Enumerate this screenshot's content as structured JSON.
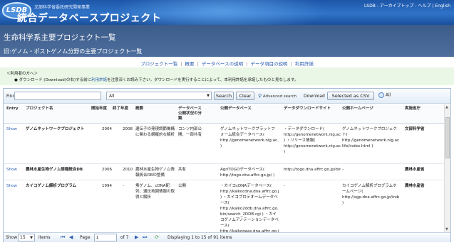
{
  "header": {
    "logo_text": "LSDB",
    "subtitle": "文部科学省委託研究開発事業",
    "brand_name": "統合データベースプロジェクト",
    "top_links": [
      "LSDB",
      "アーカイブトップ",
      "ヘルプ",
      "English"
    ],
    "top_link_separators": [
      " - ",
      " - ",
      " | "
    ]
  },
  "page": {
    "title": "生命科学系主要プロジェクト一覧",
    "subtitle": "旧:ゲノム・ポストゲノム分野の主要プロジェクト一覧"
  },
  "nav": {
    "links": [
      "プロジェクト一覧",
      "概要",
      "データベースの説明",
      "データ項目の説明",
      "利用許諾"
    ],
    "separator": "|"
  },
  "notice": {
    "heading": "＜利用者の方へ＞",
    "bullet": "●",
    "before": "ダウンロード (Download)の右)する前に",
    "link": "利用許諾",
    "after": "を注意深くお読み下さい。ダウンロードを実行することによって、本利用許諾を承諾したものと見なします。"
  },
  "toolbar": {
    "find_label": "Find",
    "find_value": "",
    "filter_value": "All",
    "search_button": "Search",
    "clear_button": "Clear",
    "advanced_search": "Advanced search",
    "download_label": "Download",
    "download_button": "Selected as CSV",
    "all_label": "All"
  },
  "columns": [
    "Entry",
    "プロジェクト名",
    "開始年度",
    "終了年度",
    "概要",
    "データベース公開状況の分類",
    "公開データベース",
    "データダウンロードサイト",
    "公開ホームページ",
    "実施省庁"
  ],
  "rows": [
    {
      "entry": "Show",
      "name": "ゲノムネットワークプロジェクト",
      "start": "2004",
      "end": "2008",
      "summary": "遺伝子の発現調節機構に関わる網羅的な解析",
      "status": "コンソ内部公開、一部共有",
      "db": "ゲノムネットワークプラットフォーム統合データベース( http://genomenetwork.nig.ac.jp/ )",
      "download": "・データダウンロード( http://genomenetwork.nig.ac.jp/public/download/dataset.html ) ・リリース情報( http://genomenetwork.nig.ac.jp/public/contents/release.html )",
      "homepage": "ゲノムネットワークプロジェクト( http://genomenetwork.nig.ac.jp/next-life/index.html )",
      "ministry": "文部科学省"
    },
    {
      "entry": "Show",
      "name": "農林水産生物ゲノム情報統合DB",
      "start": "2006",
      "end": "2010",
      "summary": "農林水産生物ゲノム情報統合DBの整備",
      "status": "共有",
      "db": "AgriTOGOデータベース( http://togo.dna.affrc.go.jp/ )",
      "download": "http://togo.dna.affrc.go.jp/download.html",
      "homepage": "-",
      "ministry": "農林水産省"
    },
    {
      "entry": "Show",
      "name": "カイコゲノム解析プログラム",
      "start": "1994",
      "end": "-",
      "summary": "蚕ゲノム、cDNA配列、遺伝地図情報の取得と解析",
      "status": "公開",
      "db": "・カイコcDNAデータベース( http://kaikocdna.dna.affrc.go.jp/ ) ・カイコプロテオームデータベース( http://kaiko2ddb.dna.affrc.go.jp/cgi-bin/search_2DDB.cgi ) ・カイコゲノムアノテーションデータベース( http://kaikogaas.dna.affrc.go.jp/ )",
      "download": "-",
      "homepage": "カイコゲノム解析プログラムホームページ( http://sgp.dna.affrc.go.jp/index.html )",
      "ministry": "農林水産省"
    }
  ],
  "pager": {
    "show_label": "Show",
    "page_size": "15",
    "items_label": "items",
    "page_label": "Page",
    "page_value": "1",
    "of_label": "of 7",
    "status": "Displaying 1 to 15 of 91 items"
  },
  "colors": {
    "header_blue": "#2f73c8",
    "title_band": "#4e6f9e",
    "notice_bg": "#eaf7e6",
    "link": "#2a5db0"
  }
}
